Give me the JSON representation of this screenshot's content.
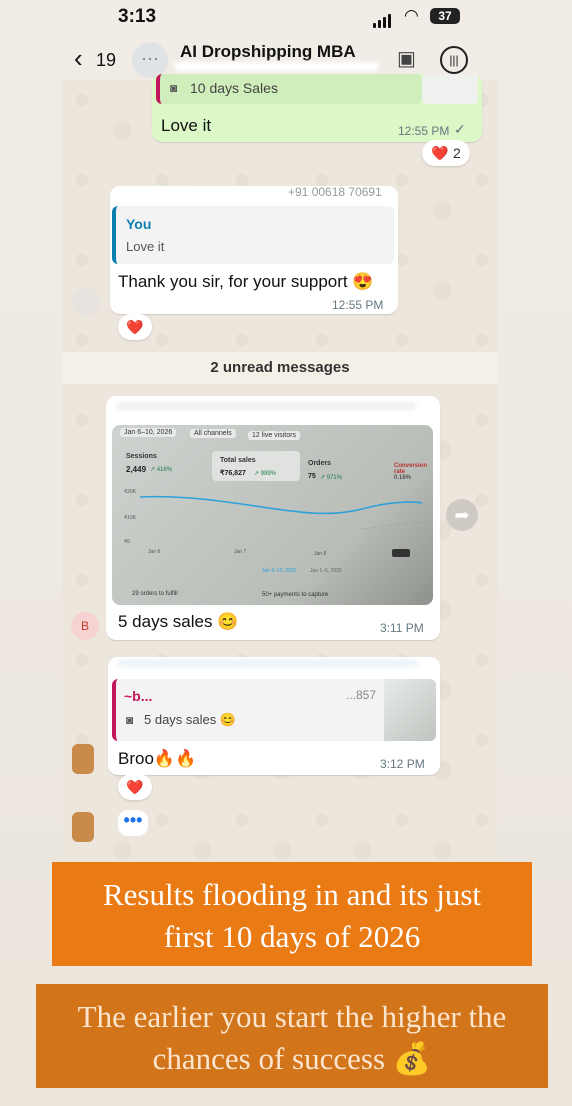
{
  "status_bar": {
    "time": "3:13",
    "battery": "37"
  },
  "header": {
    "back_count": "19",
    "title": "AI Dropshipping MBA"
  },
  "messages": {
    "m1": {
      "quote_label": "10 days Sales",
      "text": "Love it",
      "time": "12:55 PM",
      "check": "✓",
      "reaction": "❤️",
      "reaction_count": "2"
    },
    "m2": {
      "sender_blur": "~ ...",
      "sender_phone": "+91 00618 70691",
      "quote_author": "You",
      "quote_text": "Love it",
      "text": "Thank you sir, for your support 😍",
      "time": "12:55 PM",
      "reaction": "❤️"
    },
    "unread": "2 unread messages",
    "m3": {
      "avatar_letter": "B",
      "text": "5 days sales 😊",
      "time": "3:11 PM",
      "screenshot": {
        "date_chip": "Jan 6–10, 2026",
        "channels_chip": "All channels",
        "live_chip": "12 live visitors",
        "sessions_label": "Sessions",
        "sessions_value": "2,449",
        "sessions_delta": "↗ 416%",
        "sales_label": "Total sales",
        "sales_value": "₹76,827",
        "sales_delta": "↗ 999%",
        "orders_label": "Orders",
        "orders_value": "75",
        "orders_delta": "↗ 971%",
        "conv_label": "Conversion rate",
        "conv_value": "0.16%",
        "y_labels": [
          "₹20K",
          "₹10K",
          "₹0"
        ],
        "x_labels": [
          "Jan 6",
          "Jan 7",
          "Jan 8"
        ],
        "legend_current": "Jan 6–10, 2026",
        "legend_prev": "Jan 1–5, 2026",
        "footer_left": "29 orders to fulfill",
        "footer_right": "50+ payments to capture"
      }
    },
    "m4": {
      "quote_sender": "~b...",
      "quote_tail": "...857",
      "quote_text": "5 days sales 😊",
      "text": "Broo🔥🔥",
      "time": "3:12 PM",
      "reaction": "❤️"
    },
    "typing": "•••"
  },
  "banners": {
    "b1": "Results flooding in and its just first 10 days of 2026",
    "b2": "The earlier you start the higher the chances of success 💰"
  },
  "colors": {
    "out_bubble": "#dcf8c6",
    "in_bubble": "#ffffff",
    "banner": "#ea7a14",
    "chart_line": "#2ba0d9"
  }
}
